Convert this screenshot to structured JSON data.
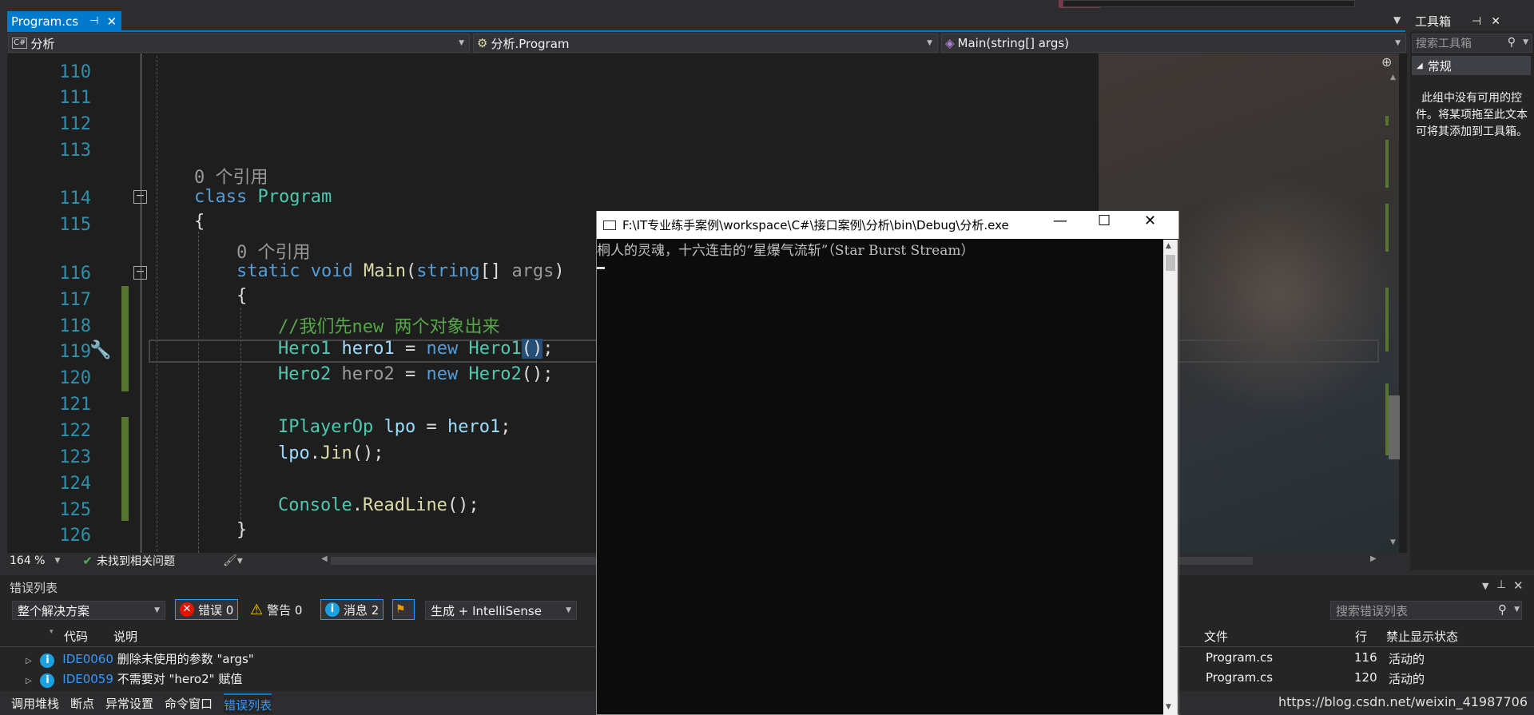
{
  "document_tab": {
    "title": "Program.cs",
    "pin": "⊣",
    "close": "✕"
  },
  "toolbox": {
    "title": "工具箱",
    "search_placeholder": "搜索工具箱",
    "group": "常规",
    "empty_text": "此组中没有可用的控件。将某项拖至此文本可将其添加到工具箱。"
  },
  "navbar": {
    "project_icon": "C#",
    "project": "分析",
    "class": "分析.Program",
    "member": "Main(string[] args)"
  },
  "editor": {
    "lines": [
      {
        "num": "110"
      },
      {
        "num": "111"
      },
      {
        "num": "112"
      },
      {
        "num": "113"
      },
      {
        "num": "114"
      },
      {
        "num": "115"
      },
      {
        "num": "116"
      },
      {
        "num": "117"
      },
      {
        "num": "118"
      },
      {
        "num": "119"
      },
      {
        "num": "120"
      },
      {
        "num": "121"
      },
      {
        "num": "122"
      },
      {
        "num": "123"
      },
      {
        "num": "124"
      },
      {
        "num": "125"
      },
      {
        "num": "126"
      }
    ],
    "refs_class": "0 个引用",
    "refs_main": "0 个引用",
    "tokens": {
      "class_kw": "class",
      "class_name": "Program",
      "open_brace": "{",
      "static_kw": "static",
      "void_kw": "void",
      "main_name": "Main",
      "main_paren": "(",
      "string_kw": "string",
      "main_rest": "[] ",
      "args": "args",
      "close_paren": ")",
      "comment": "//我们先new 两个对象出来",
      "hero1_type": "Hero1",
      "hero1_var": "hero1",
      "eq": " = ",
      "new_kw": "new",
      "hero1_ctor": "Hero1",
      "parens": "()",
      "semi": ";",
      "hero2_type": "Hero2",
      "hero2_var": "hero2",
      "hero2_ctor": "Hero2",
      "iplayer_type": "IPlayerOp",
      "lpo_var": "lpo",
      "hero1_ref": "hero1",
      "lpo_ref": "lpo",
      "dot": ".",
      "jin": "Jin",
      "callend": "();",
      "console": "Console",
      "readline": "ReadLine",
      "close_brace": "}"
    },
    "zoom": "164 %",
    "status": "未找到相关问题"
  },
  "console": {
    "title": "F:\\IT专业练手案例\\workspace\\C#\\接口案例\\分析\\bin\\Debug\\分析.exe",
    "output": "桐人的灵魂，十六连击的“星爆气流斩”（Star Burst Stream）",
    "minimize": "—",
    "maximize": "☐",
    "close": "✕"
  },
  "error_list": {
    "title": "错误列表",
    "scope": "整个解决方案",
    "errors_label": "错误 0",
    "warnings_label": "警告 0",
    "messages_label": "消息 2",
    "build_filter": "生成 + IntelliSense",
    "search_placeholder": "搜索错误列表",
    "columns": {
      "code": "代码",
      "desc": "说明",
      "file": "文件",
      "line": "行",
      "suppress": "禁止显示状态"
    },
    "rows": [
      {
        "code": "IDE0060",
        "desc": "删除未使用的参数 \"args\"",
        "file": "Program.cs",
        "line": "116",
        "state": "活动的"
      },
      {
        "code": "IDE0059",
        "desc": "不需要对 \"hero2\" 赋值",
        "file": "Program.cs",
        "line": "120",
        "state": "活动的"
      }
    ]
  },
  "bottom_tabs": [
    "调用堆栈",
    "断点",
    "异常设置",
    "命令窗口",
    "错误列表"
  ],
  "watermark": "https://blog.csdn.net/weixin_41987706",
  "colors": {
    "accent": "#007acc",
    "keyword": "#569cd6",
    "type": "#4ec9b0",
    "method": "#dcdcaa",
    "comment": "#57a64a",
    "variable": "#9cdcfe",
    "line_number": "#2b91af"
  }
}
